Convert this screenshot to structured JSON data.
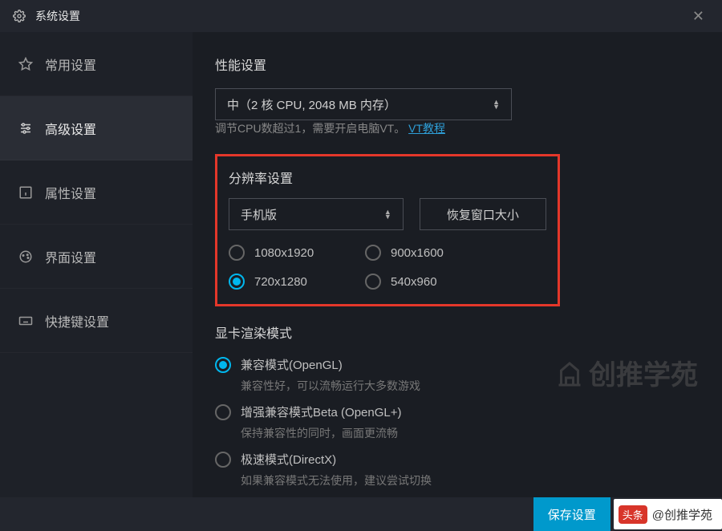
{
  "titlebar": {
    "title": "系统设置"
  },
  "sidebar": {
    "items": [
      {
        "label": "常用设置"
      },
      {
        "label": "高级设置"
      },
      {
        "label": "属性设置"
      },
      {
        "label": "界面设置"
      },
      {
        "label": "快捷键设置"
      }
    ]
  },
  "perf": {
    "title": "性能设置",
    "selected": "中（2 核 CPU, 2048 MB 内存）",
    "hint_prefix": "调节CPU数超过1，需要开启电脑VT。",
    "hint_link": "VT教程"
  },
  "resolution": {
    "title": "分辨率设置",
    "mode": "手机版",
    "restore_btn": "恢复窗口大小",
    "options": [
      "1080x1920",
      "900x1600",
      "720x1280",
      "540x960"
    ],
    "selected_index": 2
  },
  "render": {
    "title": "显卡渲染模式",
    "modes": [
      {
        "label": "兼容模式(OpenGL)",
        "desc": "兼容性好，可以流畅运行大多数游戏"
      },
      {
        "label": "增强兼容模式Beta (OpenGL+)",
        "desc": "保持兼容性的同时，画面更流畅"
      },
      {
        "label": "极速模式(DirectX)",
        "desc": "如果兼容模式无法使用，建议尝试切换"
      }
    ],
    "selected_index": 0
  },
  "footer": {
    "save": "保存设置",
    "badge_brand": "头条",
    "badge_author": "@创推学苑"
  },
  "watermark": "创推学苑"
}
